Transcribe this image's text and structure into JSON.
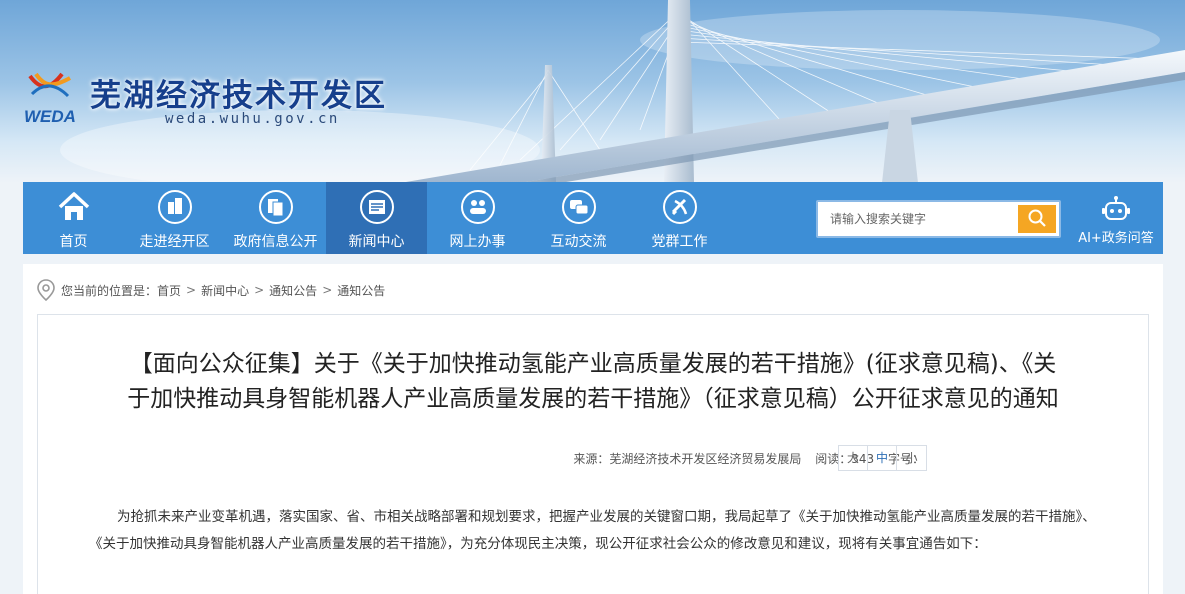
{
  "site": {
    "title": "芜湖经济技术开发区",
    "domain": "weda.wuhu.gov.cn",
    "logo_text": "WEDA"
  },
  "nav": {
    "items": [
      {
        "label": "首页",
        "icon": "home-icon"
      },
      {
        "label": "走进经开区",
        "icon": "building-icon"
      },
      {
        "label": "政府信息公开",
        "icon": "documents-icon"
      },
      {
        "label": "新闻中心",
        "icon": "newspaper-icon",
        "active": true
      },
      {
        "label": "网上办事",
        "icon": "hands-icon"
      },
      {
        "label": "互动交流",
        "icon": "chat-icon"
      },
      {
        "label": "党群工作",
        "icon": "party-emblem-icon"
      }
    ],
    "search_placeholder": "请输入搜索关键字",
    "ai_label": "AI+政务问答"
  },
  "breadcrumb": {
    "prefix": "您当前的位置是：",
    "items": [
      "首页",
      "新闻中心",
      "通知公告",
      "通知公告"
    ],
    "separator": ">"
  },
  "article": {
    "title_line1": "【面向公众征集】关于《关于加快推动氢能产业高质量发展的若干措施》(征求意见稿)、《关",
    "title_line2": "于加快推动具身智能机器人产业高质量发展的若干措施》（征求意见稿）公开征求意见的通知",
    "source_label": "来源：",
    "source": "芜湖经济技术开发区经济贸易发展局",
    "views_label": "阅读：",
    "views": "343",
    "font_size_label": "字号：",
    "font_sizes": [
      "大",
      "中",
      "小"
    ],
    "body": "为抢抓未来产业变革机遇，落实国家、省、市相关战略部署和规划要求，把握产业发展的关键窗口期，我局起草了《关于加快推动氢能产业高质量发展的若干措施》、《关于加快推动具身智能机器人产业高质量发展的若干措施》，为充分体现民主决策，现公开征求社会公众的修改意见和建议，现将有关事宜通告如下："
  },
  "colors": {
    "nav_bg": "#3d8ed6",
    "nav_active": "#2f6fb5",
    "search_button": "#f5a623",
    "title_blue": "#163f8c"
  }
}
